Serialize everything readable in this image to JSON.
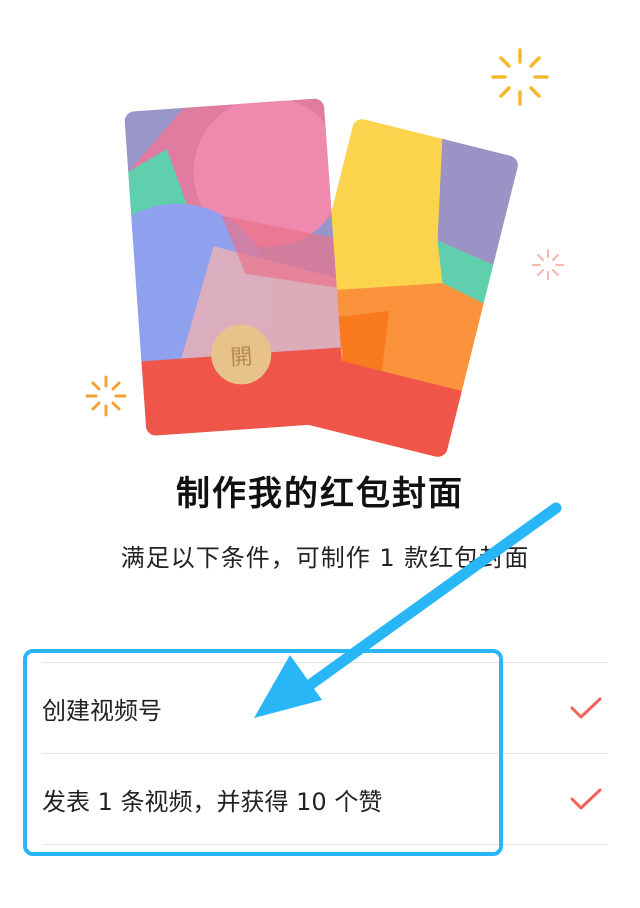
{
  "hero": {
    "seal_char": "開"
  },
  "page": {
    "title": "制作我的红包封面",
    "subtitle": "满足以下条件，可制作 1 款红包封面"
  },
  "conditions": [
    {
      "label": "创建视频号",
      "met": true
    },
    {
      "label": "发表 1 条视频，并获得 10 个赞",
      "met": true
    }
  ],
  "colors": {
    "check": "#f0625a",
    "highlight": "#29b6f6",
    "sparkle": "#f5b82e",
    "cover_red": "#ef5548"
  }
}
